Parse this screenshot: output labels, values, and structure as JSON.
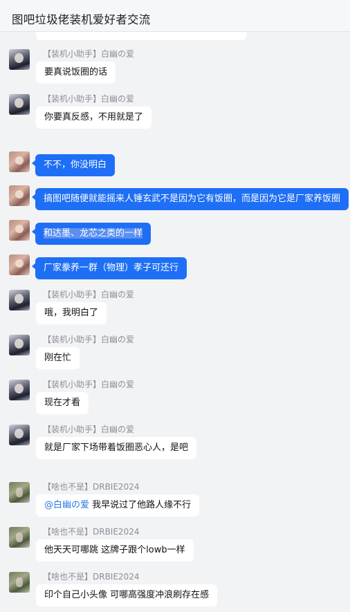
{
  "header": {
    "title": "图吧垃圾佬装机爱好者交流"
  },
  "messages": [
    {
      "sender": "【装机小助手】白幽の爱",
      "text": "要真说饭圈的话"
    },
    {
      "sender": "【装机小助手】白幽の爱",
      "text": "你要真反感，不用就是了"
    },
    {
      "text": "不不，你没明白"
    },
    {
      "text": "搞图吧随便就能摇来人锤玄武不是因为它有饭圈，而是因为它是厂家养饭圈"
    },
    {
      "text": "和达墨、龙芯之类的一样"
    },
    {
      "text": "厂家豢养一群（物理）孝子可还行"
    },
    {
      "sender": "【装机小助手】白幽の爱",
      "text": "哦，我明白了"
    },
    {
      "sender": "【装机小助手】白幽の爱",
      "text": "刚在忙"
    },
    {
      "sender": "【装机小助手】白幽の爱",
      "text": "现在才看"
    },
    {
      "sender": "【装机小助手】白幽の爱",
      "text": "就是厂家下场带着饭圈恶心人，是吧"
    },
    {
      "sender": "【啥也不是】DRBIE2024",
      "mention": "@白幽の爱",
      "text": " 我早说过了他路人缘不行"
    },
    {
      "sender": "【啥也不是】DRBIE2024",
      "text": "他天天可哪跳 这牌子跟个lowb一样"
    },
    {
      "sender": "【啥也不是】DRBIE2024",
      "text": "印个自己小头像  可哪高强度冲浪刷存在感"
    }
  ]
}
